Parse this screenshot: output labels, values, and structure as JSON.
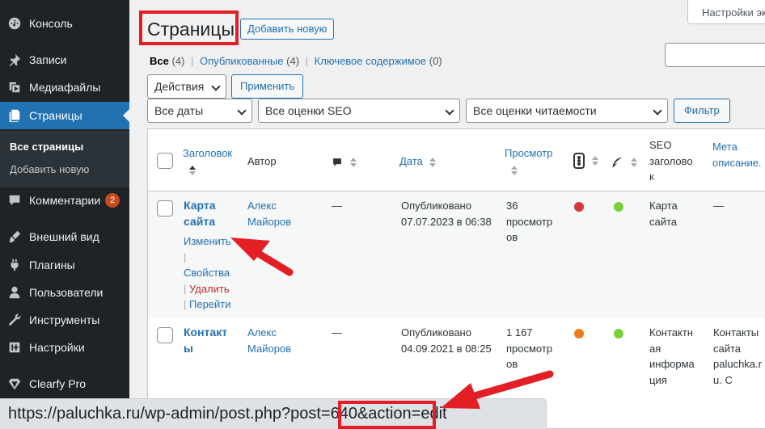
{
  "sidebar": {
    "items": [
      {
        "label": "Консоль",
        "icon": "dashboard-icon"
      },
      {
        "label": "Записи",
        "icon": "pin-icon"
      },
      {
        "label": "Медиафайлы",
        "icon": "media-icon"
      },
      {
        "label": "Страницы",
        "icon": "pages-icon"
      },
      {
        "label": "Комментарии",
        "icon": "comments-icon",
        "badge": "2"
      },
      {
        "label": "Внешний вид",
        "icon": "appearance-icon"
      },
      {
        "label": "Плагины",
        "icon": "plugins-icon"
      },
      {
        "label": "Пользователи",
        "icon": "users-icon"
      },
      {
        "label": "Инструменты",
        "icon": "tools-icon"
      },
      {
        "label": "Настройки",
        "icon": "settings-icon"
      },
      {
        "label": "Clearfy Pro",
        "icon": "diamond-icon"
      }
    ],
    "submenu": [
      {
        "label": "Все страницы"
      },
      {
        "label": "Добавить новую"
      }
    ]
  },
  "header": {
    "screen_options": "Настройки эк",
    "title": "Страницы",
    "add_new": "Добавить новую"
  },
  "views": {
    "all": "Все",
    "all_count": "(4)",
    "published": "Опубликованные",
    "published_count": "(4)",
    "cornerstone": "Ключевое содержимое",
    "cornerstone_count": "(0)"
  },
  "bulk": {
    "actions": "Действия",
    "apply": "Применить"
  },
  "filters": {
    "dates": "Все даты",
    "seo": "Все оценки SEO",
    "readability": "Все оценки читаемости",
    "filter_button": "Фильтр"
  },
  "table": {
    "headers": {
      "title": "Заголовок",
      "author": "Автор",
      "date": "Дата",
      "views": "Просмотр",
      "seo_title_1": "SEO",
      "seo_title_2": "заголово",
      "seo_title_3": "к",
      "meta_1": "Мета",
      "meta_2": "описание."
    },
    "rows": [
      {
        "title_1": "Карта",
        "title_2": "сайта",
        "edit": "Изменить",
        "props": "Свойства",
        "delete": "Удалить",
        "view": "Перейти",
        "author_1": "Алекс",
        "author_2": "Майоров",
        "comments": "—",
        "date_1": "Опубликовано",
        "date_2": "07.07.2023 в 06:38",
        "views_1": "36",
        "views_2": "просмотр",
        "views_3": "ов",
        "seo_color": "#d63638",
        "read_color": "#7ad03a",
        "seo_title_1": "Карта",
        "seo_title_2": "сайта",
        "meta": "—"
      },
      {
        "title_1": "Контакт",
        "title_2": "ы",
        "author_1": "Алекс",
        "author_2": "Майоров",
        "comments": "—",
        "date_1": "Опубликовано",
        "date_2": "04.09.2021 в 08:25",
        "views_1": "1 167",
        "views_2": "просмотр",
        "views_3": "ов",
        "seo_color": "#ee7c1b",
        "read_color": "#7ad03a",
        "seo_title_1": "Контактн",
        "seo_title_2": "ая",
        "seo_title_3": "информа",
        "seo_title_4": "ция",
        "meta_1": "Контакты",
        "meta_2": "сайта",
        "meta_3": "paluchka.r",
        "meta_4": "u. С"
      }
    ]
  },
  "statusbar": {
    "url": "https://paluchka.ru/wp-admin/post.php?post=640&action=edit"
  },
  "colors": {
    "accent": "#2271b1",
    "highlight": "#e31e24"
  }
}
